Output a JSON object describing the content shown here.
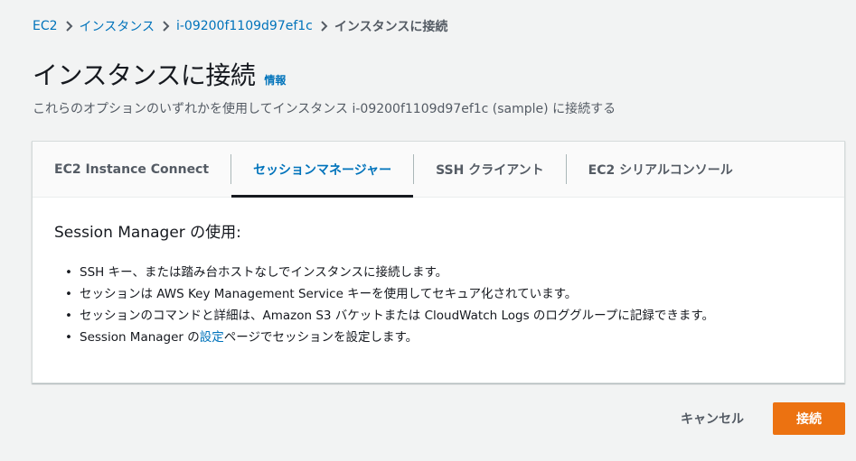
{
  "breadcrumb": {
    "items": [
      "EC2",
      "インスタンス",
      "i-09200f1109d97ef1c"
    ],
    "current": "インスタンスに接続"
  },
  "header": {
    "title": "インスタンスに接続",
    "info_label": "情報",
    "subtitle": "これらのオプションのいずれかを使用してインスタンス i-09200f1109d97ef1c (sample) に接続する"
  },
  "tabs": [
    {
      "label": "EC2 Instance Connect",
      "active": false
    },
    {
      "label": "セッションマネージャー",
      "active": true
    },
    {
      "label": "SSH クライアント",
      "active": false
    },
    {
      "label": "EC2 シリアルコンソール",
      "active": false
    }
  ],
  "session_manager": {
    "heading": "Session Manager の使用:",
    "bullets": [
      "SSH キー、または踏み台ホストなしでインスタンスに接続します。",
      "セッションは AWS Key Management Service キーを使用してセキュア化されています。",
      "セッションのコマンドと詳細は、Amazon S3 バケットまたは CloudWatch Logs のロググループに記録できます。"
    ],
    "last_bullet": {
      "prefix": "Session Manager の",
      "link": "設定",
      "suffix": "ページでセッションを設定します。"
    }
  },
  "actions": {
    "cancel_label": "キャンセル",
    "connect_label": "接続"
  },
  "colors": {
    "link": "#0073bb",
    "primary": "#ec7211",
    "background": "#f2f3f3"
  }
}
